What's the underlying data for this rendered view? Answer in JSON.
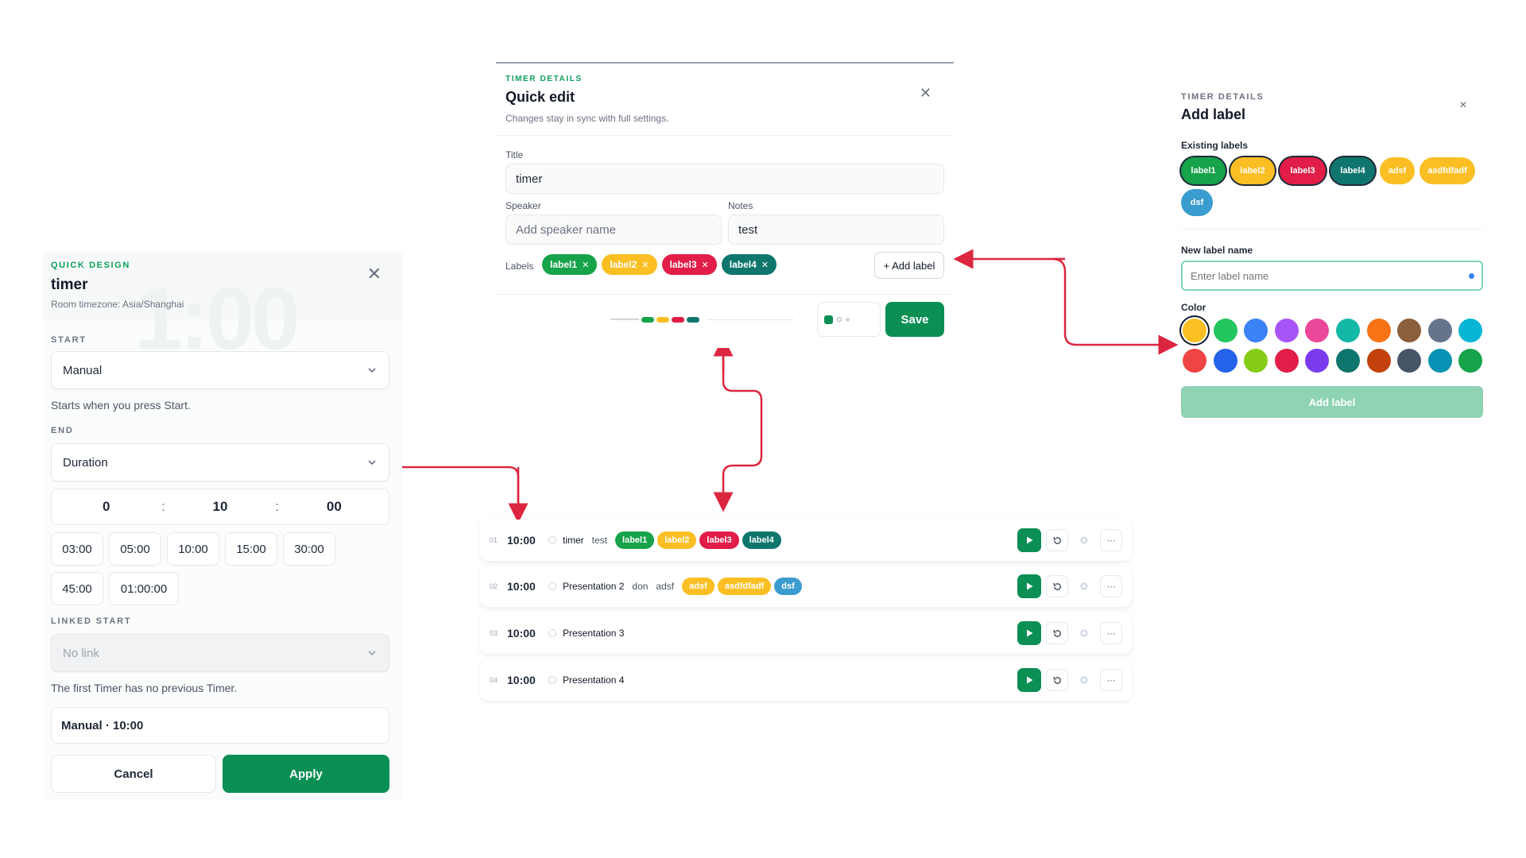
{
  "colors": {
    "green": "#0b8f54",
    "label1": "#16a34a",
    "label2": "#fbbf24",
    "label3": "#e11d48",
    "label4": "#0f766e",
    "adsf": "#fbbf24",
    "asdfdfadf": "#fbbf24",
    "dsf": "#3b9ccf",
    "arrow": "#dc2640"
  },
  "quick_design": {
    "eyebrow": "QUICK DESIGN",
    "title": "timer",
    "subtitle": "Room timezone: Asia/Shanghai",
    "bg_text": "1:00",
    "start_label": "START",
    "start_value": "Manual",
    "start_hint": "Starts when you press Start.",
    "end_label": "END",
    "end_value": "Duration",
    "time": {
      "h": "0",
      "m": "10",
      "s": "00",
      "sep": ":"
    },
    "presets": [
      "03:00",
      "05:00",
      "10:00",
      "15:00",
      "30:00",
      "45:00",
      "01:00:00"
    ],
    "linked_label": "LINKED START",
    "linked_value": "No link",
    "linked_hint": "The first Timer has no previous Timer.",
    "summary": "Manual · 10:00",
    "cancel": "Cancel",
    "apply": "Apply"
  },
  "quick_edit": {
    "eyebrow": "TIMER DETAILS",
    "title": "Quick edit",
    "subtitle": "Changes stay in sync with full settings.",
    "title_label": "Title",
    "title_value": "timer",
    "speaker_label": "Speaker",
    "speaker_placeholder": "Add speaker name",
    "notes_label": "Notes",
    "notes_value": "test",
    "labels_label": "Labels",
    "labels": [
      "label1",
      "label2",
      "label3",
      "label4"
    ],
    "add_label": "+ Add label",
    "save": "Save"
  },
  "add_label": {
    "eyebrow": "TIMER DETAILS",
    "title": "Add label",
    "existing_label": "Existing labels",
    "existing": [
      "label1",
      "label2",
      "label3",
      "label4",
      "adsf",
      "asdfdfadf",
      "dsf"
    ],
    "new_name_label": "New label name",
    "placeholder": "Enter label name",
    "color_label": "Color",
    "swatches": [
      "#fbbf24",
      "#22c55e",
      "#3b82f6",
      "#a855f7",
      "#ec4899",
      "#14b8a6",
      "#f97316",
      "#8b5e3c",
      "#64748b",
      "#06b6d4",
      "#ef4444",
      "#2563eb",
      "#84cc16",
      "#e11d48",
      "#7c3aed",
      "#0f766e",
      "#c2410c",
      "#475569",
      "#0891b2",
      "#16a34a"
    ],
    "button": "Add label"
  },
  "timers": [
    {
      "idx": "01",
      "dur": "10:00",
      "name": "timer",
      "speaker": "test",
      "labels": [
        "label1",
        "label2",
        "label3",
        "label4"
      ]
    },
    {
      "idx": "02",
      "dur": "10:00",
      "name": "Presentation 2",
      "speaker": "don",
      "extra": "adsf",
      "labels": [
        "adsf",
        "asdfdfadf",
        "dsf"
      ]
    },
    {
      "idx": "03",
      "dur": "10:00",
      "name": "Presentation 3",
      "speaker": "",
      "labels": []
    },
    {
      "idx": "04",
      "dur": "10:00",
      "name": "Presentation 4",
      "speaker": "",
      "labels": []
    }
  ]
}
